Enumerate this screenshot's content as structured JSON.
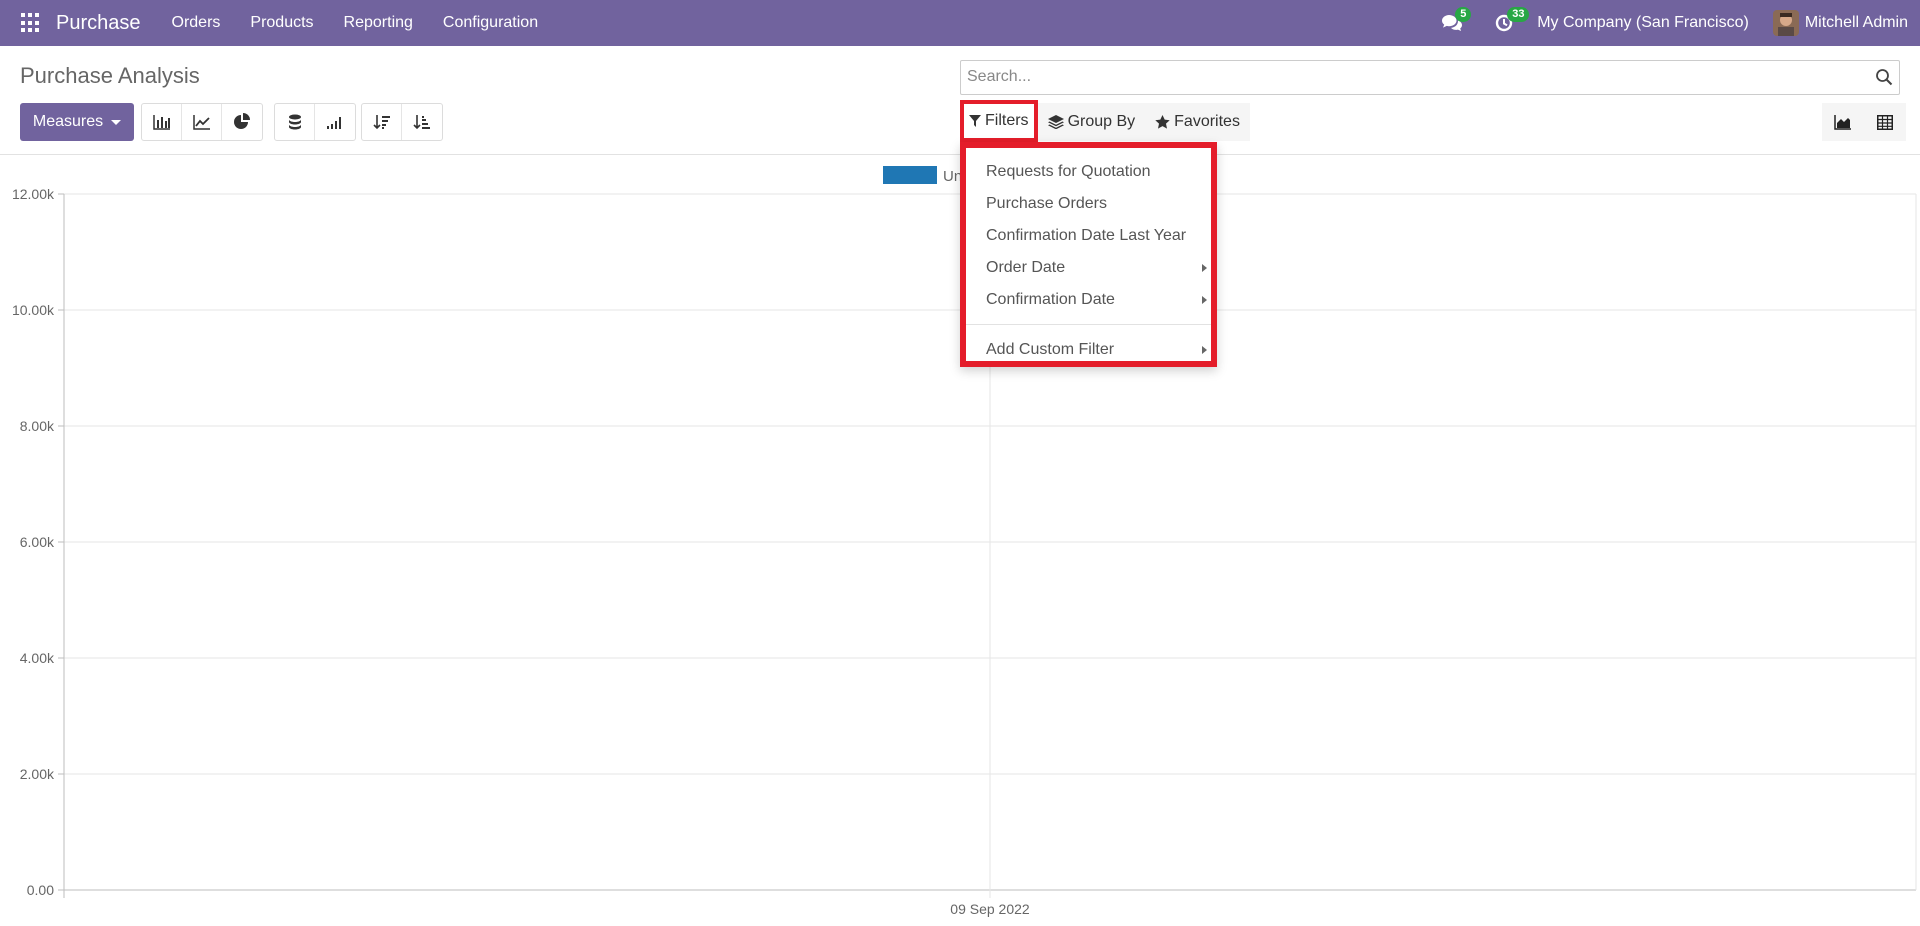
{
  "navbar": {
    "app_name": "Purchase",
    "menu": [
      "Orders",
      "Products",
      "Reporting",
      "Configuration"
    ],
    "messages_badge": "5",
    "activities_badge": "33",
    "company": "My Company (San Francisco)",
    "user": "Mitchell Admin"
  },
  "page": {
    "title": "Purchase Analysis"
  },
  "search": {
    "placeholder": "Search..."
  },
  "toolbar": {
    "measures_label": "Measures"
  },
  "filter_bar": {
    "filters_label": "Filters",
    "group_by_label": "Group By",
    "favorites_label": "Favorites"
  },
  "filters_menu": {
    "items": [
      {
        "label": "Requests for Quotation",
        "submenu": false
      },
      {
        "label": "Purchase Orders",
        "submenu": false
      },
      {
        "label": "Confirmation Date Last Year",
        "submenu": false
      },
      {
        "label": "Order Date",
        "submenu": true
      },
      {
        "label": "Confirmation Date",
        "submenu": true
      }
    ],
    "custom_filter_label": "Add Custom Filter"
  },
  "colors": {
    "brand": "#71639e",
    "badge": "#28a745",
    "highlight": "#e41d2a",
    "series": "#1f77b4"
  },
  "chart_data": {
    "type": "bar",
    "categories": [
      "09 Sep 2022"
    ],
    "series": [
      {
        "name": "Un",
        "values": [
          0
        ]
      }
    ],
    "ylim": [
      0,
      12000
    ],
    "yticks": [
      "0.00",
      "2.00k",
      "4.00k",
      "6.00k",
      "8.00k",
      "10.00k",
      "12.00k"
    ],
    "grid": true,
    "legend": "top-center"
  }
}
